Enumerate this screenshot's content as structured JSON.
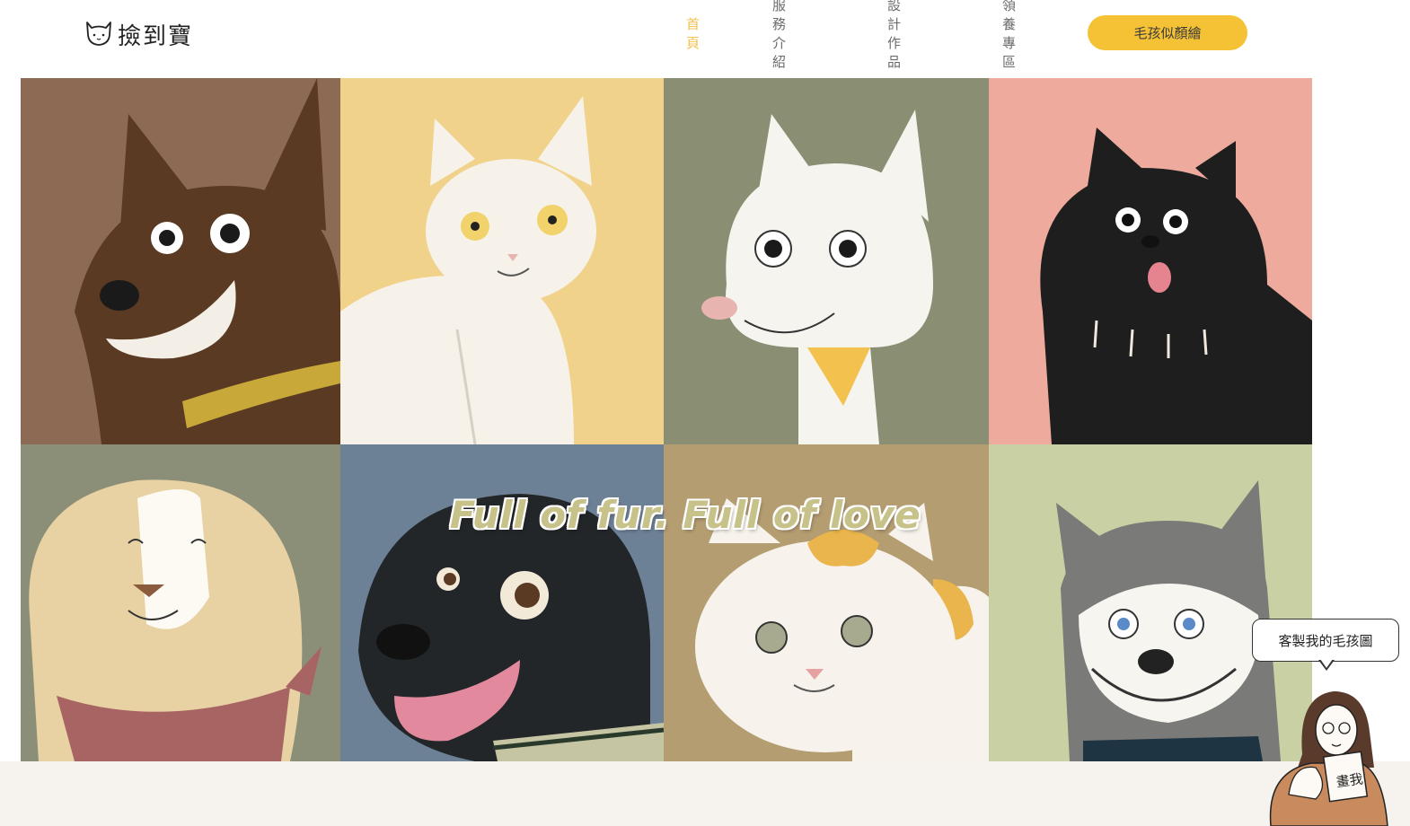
{
  "header": {
    "logo_text": "撿到寶",
    "logo_icon": "cat-face-icon",
    "nav": [
      "首頁",
      "服務介紹",
      "設計作品",
      "領養專區"
    ],
    "active_nav": "首頁",
    "cta_label": "毛孩似顏繪",
    "accent_color": "#f5c236"
  },
  "hero": {
    "tagline": "Full of fur. Full of love",
    "tiles": [
      {
        "animal": "brown dog",
        "bg": "#8c6a54"
      },
      {
        "animal": "white cat",
        "bg": "#f1d28b"
      },
      {
        "animal": "white dog",
        "bg": "#8a8e72"
      },
      {
        "animal": "black dog",
        "bg": "#eeaa9c"
      },
      {
        "animal": "golden dog",
        "bg": "#8c8f78"
      },
      {
        "animal": "black labrador",
        "bg": "#6d8196"
      },
      {
        "animal": "calico cat",
        "bg": "#b59d72"
      },
      {
        "animal": "husky",
        "bg": "#c8d0a4"
      }
    ]
  },
  "widget": {
    "bubble_text": "客製我的毛孩圖",
    "sign_text": "畫我"
  }
}
